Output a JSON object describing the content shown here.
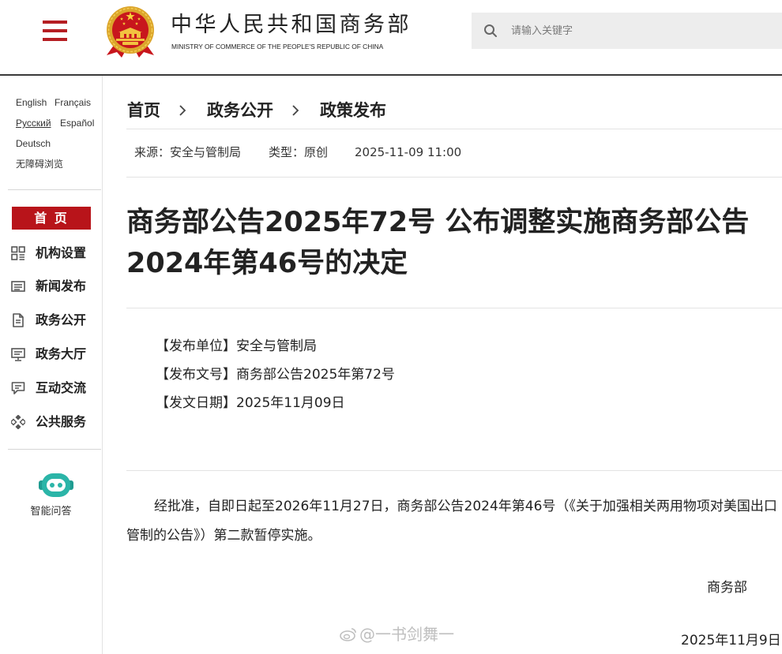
{
  "header": {
    "title": "中华人民共和国商务部",
    "subtitle": "MINISTRY OF COMMERCE OF THE PEOPLE'S REPUBLIC OF CHINA",
    "menu_icon": "hamburger-menu-icon",
    "emblem_icon": "national-emblem-icon",
    "search": {
      "placeholder": "请输入关键字",
      "value": "",
      "icon": "search-icon"
    }
  },
  "sidebar": {
    "languages": [
      "English",
      "Français",
      "Русский",
      "Español",
      "Deutsch"
    ],
    "accessibility": "无障碍浏览",
    "home": "首 页",
    "menu": [
      {
        "label": "机构设置",
        "icon": "grid-icon"
      },
      {
        "label": "新闻发布",
        "icon": "newspaper-icon"
      },
      {
        "label": "政务公开",
        "icon": "document-icon"
      },
      {
        "label": "政务大厅",
        "icon": "monitor-icon"
      },
      {
        "label": "互动交流",
        "icon": "chat-icon"
      },
      {
        "label": "公共服务",
        "icon": "service-icon"
      }
    ],
    "assistant": {
      "label": "智能问答",
      "icon": "robot-icon"
    }
  },
  "breadcrumb": {
    "items": [
      "首页",
      "政务公开",
      "政策发布"
    ],
    "separator_icon": "chevron-right-icon"
  },
  "article": {
    "meta": {
      "source_label": "来源：",
      "source": "安全与管制局",
      "type_label": "类型：",
      "type": "原创",
      "datetime": "2025-11-09 11:00"
    },
    "title": "商务部公告2025年72号 公布调整实施商务部公告2024年第46号的决定",
    "info": [
      {
        "label": "【发布单位】",
        "value": "安全与管制局"
      },
      {
        "label": "【发布文号】",
        "value": "商务部公告2025年第72号"
      },
      {
        "label": "【发文日期】",
        "value": "2025年11月09日"
      }
    ],
    "body": "经批准，自即日起至2026年11月27日，商务部公告2024年第46号（《关于加强相关两用物项对美国出口管制的公告》）第二款暂停实施。",
    "signature": "商务部",
    "date": "2025年11月9日"
  },
  "watermark": {
    "text": "@一书剑舞一",
    "icon": "weibo-logo-icon"
  },
  "colors": {
    "brand_red": "#b8141a",
    "menu_icon_red": "#b51e23",
    "text": "#222222",
    "assistant_teal": "#2bb5a8",
    "search_background": "#ededed",
    "divider": "#e3e3e3"
  }
}
